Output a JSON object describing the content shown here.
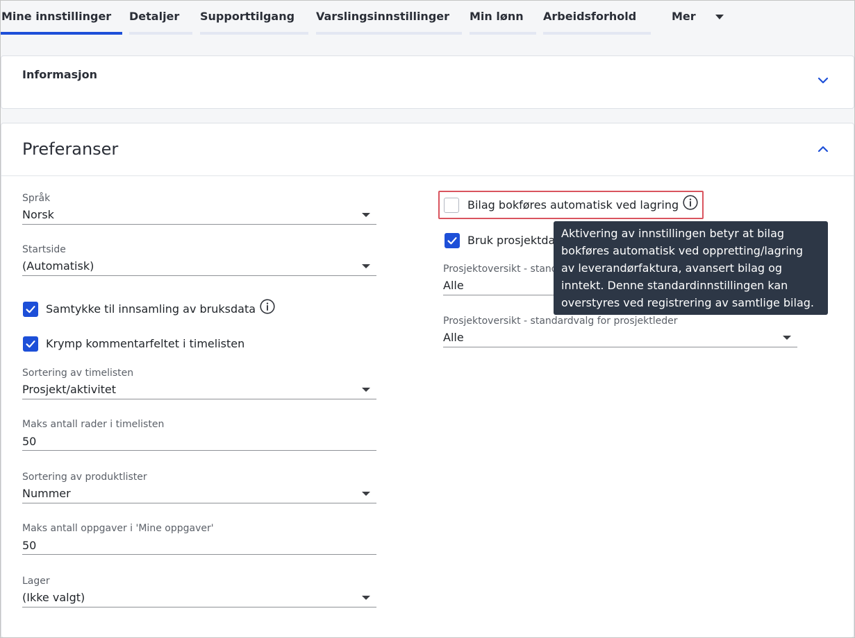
{
  "tabs": {
    "items": [
      {
        "label": "Mine innstillinger",
        "active": true
      },
      {
        "label": "Detaljer",
        "active": false
      },
      {
        "label": "Supporttilgang",
        "active": false
      },
      {
        "label": "Varslingsinnstillinger",
        "active": false
      },
      {
        "label": "Min lønn",
        "active": false
      },
      {
        "label": "Arbeidsforhold",
        "active": false
      }
    ],
    "more_label": "Mer"
  },
  "info_section": {
    "title": "Informasjon",
    "expanded": false
  },
  "preferences": {
    "title": "Preferanser",
    "expanded": true,
    "language": {
      "label": "Språk",
      "value": "Norsk"
    },
    "start_page": {
      "label": "Startside",
      "value": "(Automatisk)"
    },
    "usage_data_consent": {
      "label": "Samtykke til innsamling av bruksdata",
      "checked": true
    },
    "shrink_comment_field": {
      "label": "Krymp kommentarfeltet i timelisten",
      "checked": true
    },
    "timesheet_sorting": {
      "label": "Sortering av timelisten",
      "value": "Prosjekt/aktivitet"
    },
    "max_timesheet_rows": {
      "label": "Maks antall rader i timelisten",
      "value": "50"
    },
    "product_list_sorting": {
      "label": "Sortering av produktlister",
      "value": "Nummer"
    },
    "max_my_tasks": {
      "label": "Maks antall oppgaver i 'Mine oppgaver'",
      "value": "50"
    },
    "warehouse": {
      "label": "Lager",
      "value": "(Ikke valgt)"
    },
    "auto_post_vouchers": {
      "label": "Bilag bokføres automatisk ved lagring",
      "checked": false
    },
    "use_project_data": {
      "label": "Bruk prosjektda",
      "checked": true
    },
    "project_overview_default": {
      "label": "Prosjektoversikt - stand",
      "value": "Alle"
    },
    "project_overview_manager_default": {
      "label": "Prosjektoversikt - standardvalg for prosjektleder",
      "value": "Alle"
    }
  },
  "tooltip": {
    "lines": [
      "Aktivering av innstillingen betyr at bilag",
      "bokføres automatisk ved oppretting/lagring",
      "av leverandørfaktura, avansert bilag og",
      "inntekt. Denne standardinnstillingen kan",
      "overstyres ved registrering av samtlige bilag."
    ]
  },
  "icons": {
    "collapsed_section": "chevron-down-icon",
    "expanded_section": "chevron-up-icon",
    "help": "info-icon",
    "dropdown": "caret-down-icon",
    "checked": "checkmark-icon"
  },
  "colors": {
    "accent": "#1d4fd8",
    "tooltip_bg": "#2d3746",
    "highlight_border": "#d9545e"
  }
}
